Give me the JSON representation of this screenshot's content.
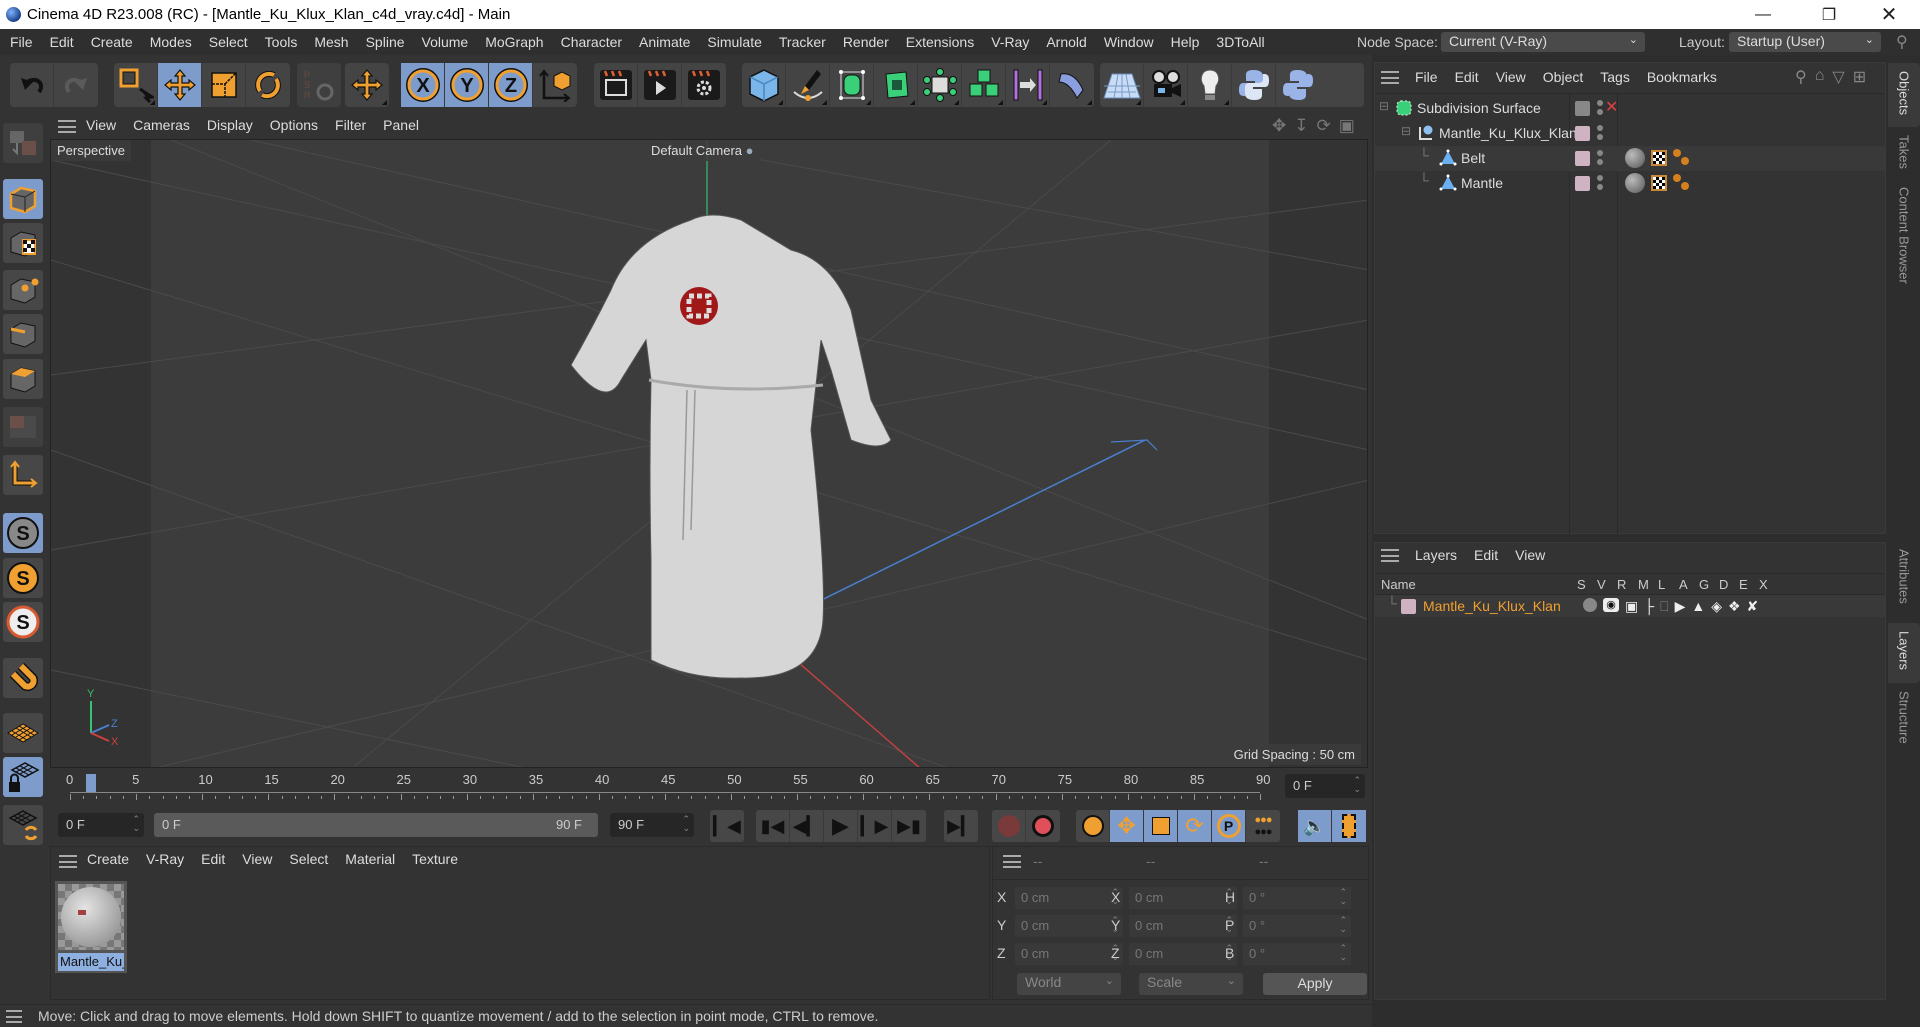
{
  "window": {
    "title": "Cinema 4D R23.008 (RC) - [Mantle_Ku_Klux_Klan_c4d_vray.c4d] - Main",
    "controls": [
      "minimize",
      "restore",
      "close"
    ]
  },
  "menubar": {
    "items": [
      "File",
      "Edit",
      "Create",
      "Modes",
      "Select",
      "Tools",
      "Mesh",
      "Spline",
      "Volume",
      "MoGraph",
      "Character",
      "Animate",
      "Simulate",
      "Tracker",
      "Render",
      "Extensions",
      "V-Ray",
      "Arnold",
      "Window",
      "Help",
      "3DToAll"
    ],
    "node_space_label": "Node Space:",
    "node_space_value": "Current (V-Ray)",
    "layout_label": "Layout:",
    "layout_value": "Startup (User)"
  },
  "toolbar": {
    "groups": [
      [
        "undo-icon",
        "redo-icon"
      ],
      [
        "live-selection-icon",
        "move-icon",
        "scale-icon",
        "rotate-icon"
      ],
      [
        "psr-icon"
      ],
      [
        "axis-move-icon"
      ],
      [
        "x-axis-lock-icon",
        "y-axis-lock-icon",
        "z-axis-lock-icon",
        "coordinate-system-icon"
      ],
      [
        "render-view-icon",
        "render-picture-viewer-icon",
        "render-settings-icon"
      ],
      [
        "cube-icon",
        "pen-icon",
        "subdivision-icon",
        "extrude-icon",
        "deformer-icon",
        "mograph-cloner-icon",
        "symmetry-icon",
        "bend-icon"
      ],
      [
        "floor-icon",
        "camera-icon",
        "light-icon",
        "python-icon",
        "python-alt-icon"
      ]
    ],
    "selected": [
      "move-icon",
      "x-axis-lock-icon",
      "y-axis-lock-icon",
      "z-axis-lock-icon"
    ]
  },
  "left_toolbar": {
    "items": [
      "make-editable-icon",
      "model-mode-icon",
      "texture-mode-icon",
      "points-mode-icon",
      "edges-mode-icon",
      "polygons-mode-icon",
      "uv-mode-icon",
      "workplane-axis-icon",
      "snap-icon",
      "snap-settings-icon",
      "quantize-icon",
      "magnet-icon",
      "floor-grid-icon",
      "locked-workplane-icon",
      "workplane-cycle-icon"
    ],
    "selected": [
      "model-mode-icon",
      "snap-icon",
      "locked-workplane-icon"
    ]
  },
  "viewport": {
    "menu": [
      "View",
      "Cameras",
      "Display",
      "Options",
      "Filter",
      "Panel"
    ],
    "view_name": "Perspective",
    "camera": "Default Camera",
    "grid_spacing": "Grid Spacing : 50 cm",
    "axis_labels": {
      "x": "X",
      "y": "Y",
      "z": "Z"
    }
  },
  "timeline": {
    "ticks": [
      "0",
      "5",
      "10",
      "15",
      "20",
      "25",
      "30",
      "35",
      "40",
      "45",
      "50",
      "55",
      "60",
      "65",
      "70",
      "75",
      "80",
      "85",
      "90"
    ],
    "current_frame_field": "0 F",
    "start_field": "0 F",
    "range_start": "0 F",
    "range_end": "90 F",
    "end_field": "90 F",
    "current_position": 0,
    "max_frame": 90
  },
  "playback": {
    "buttons": [
      "go-to-start",
      "previous-key",
      "previous-frame",
      "play",
      "next-frame",
      "next-key",
      "go-to-end"
    ],
    "record_buttons": [
      "autokey",
      "record"
    ],
    "key_buttons": [
      "keyframe-settings",
      "key-position",
      "key-scale",
      "key-rotation",
      "key-parameter",
      "key-pla"
    ],
    "extra_buttons": [
      "sound",
      "timeline-toggle"
    ]
  },
  "material_manager": {
    "menu": [
      "Create",
      "V-Ray",
      "Edit",
      "View",
      "Select",
      "Material",
      "Texture"
    ],
    "materials": [
      {
        "name": "Mantle_Ku_",
        "selected": true
      }
    ]
  },
  "coordinates": {
    "headers": [
      "--",
      "--",
      "--"
    ],
    "position": [
      {
        "axis": "X",
        "value": "0 cm"
      },
      {
        "axis": "Y",
        "value": "0 cm"
      },
      {
        "axis": "Z",
        "value": "0 cm"
      }
    ],
    "size": [
      {
        "axis": "X",
        "value": "0 cm"
      },
      {
        "axis": "Y",
        "value": "0 cm"
      },
      {
        "axis": "Z",
        "value": "0 cm"
      }
    ],
    "rotation": [
      {
        "axis": "H",
        "value": "0 °"
      },
      {
        "axis": "P",
        "value": "0 °"
      },
      {
        "axis": "B",
        "value": "0 °"
      }
    ],
    "space_select": "World",
    "mode_select": "Scale",
    "apply_label": "Apply"
  },
  "object_manager": {
    "menu": [
      "File",
      "Edit",
      "View",
      "Object",
      "Tags",
      "Bookmarks"
    ],
    "objects": [
      {
        "name": "Subdivision Surface",
        "level": 0,
        "icon": "subdivision-surface-icon",
        "tags": []
      },
      {
        "name": "Mantle_Ku_Klux_Klan",
        "level": 1,
        "icon": "null-object-icon",
        "tags": []
      },
      {
        "name": "Belt",
        "level": 2,
        "icon": "polygon-object-icon",
        "tags": [
          "material-tag",
          "uvw-tag",
          "vray-tag"
        ]
      },
      {
        "name": "Mantle",
        "level": 2,
        "icon": "polygon-object-icon",
        "tags": [
          "material-tag",
          "uvw-tag",
          "vray-tag"
        ]
      }
    ]
  },
  "layer_manager": {
    "menu": [
      "Layers",
      "Edit",
      "View"
    ],
    "columns": [
      "Name",
      "S",
      "V",
      "R",
      "M",
      "L",
      "A",
      "G",
      "D",
      "E",
      "X"
    ],
    "layers": [
      {
        "name": "Mantle_Ku_Klux_Klan",
        "color": "#cfb3c3"
      }
    ]
  },
  "side_tabs": {
    "top": [
      {
        "label": "Objects",
        "active": true
      },
      {
        "label": "Takes",
        "active": false
      },
      {
        "label": "Content Browser",
        "active": false
      }
    ],
    "bottom": [
      {
        "label": "Attributes",
        "active": false
      },
      {
        "label": "Layers",
        "active": true
      },
      {
        "label": "Structure",
        "active": false
      }
    ]
  },
  "status": {
    "text": "Move: Click and drag to move elements. Hold down SHIFT to quantize movement / add to the selection in point mode, CTRL to remove."
  },
  "colors": {
    "accent_selected": "#7d9ccc",
    "orange": "#f0a030",
    "layer_name": "#f0a030",
    "axis_x": "#d04040",
    "axis_y": "#40c070",
    "axis_z": "#4070c0"
  }
}
